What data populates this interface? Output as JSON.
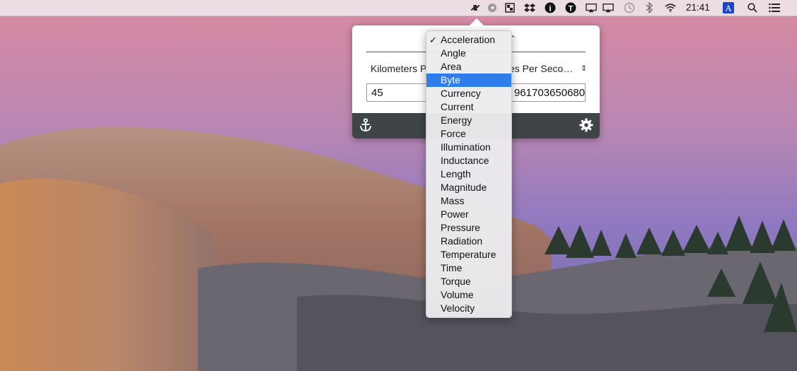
{
  "menubar": {
    "clock": "21:41",
    "icons": [
      "unit-converter-icon",
      "gray-circle-icon",
      "hex-grid-icon",
      "dropbox-icon",
      "info-icon",
      "t-icon",
      "airplay-icon",
      "time-machine-icon",
      "bluetooth-icon",
      "wifi-icon",
      "input-source-icon",
      "spotlight-icon",
      "notification-center-icon"
    ],
    "input_source_letter": "A",
    "t_letter": "T",
    "info_letter": "i"
  },
  "converter": {
    "from_unit": "Kilometers P",
    "to_unit": "es Per Seco…",
    "from_value": "45",
    "to_value": "961703650680"
  },
  "menu": {
    "checked_item": "Acceleration",
    "selected_item": "Byte",
    "items": [
      "Acceleration",
      "Angle",
      "Area",
      "Byte",
      "Currency",
      "Current",
      "Energy",
      "Force",
      "Illumination",
      "Inductance",
      "Length",
      "Magnitude",
      "Mass",
      "Power",
      "Pressure",
      "Radiation",
      "Temperature",
      "Time",
      "Torque",
      "Volume",
      "Velocity"
    ]
  },
  "colors": {
    "highlight": "#2f7dea",
    "footer": "#3f4446"
  }
}
